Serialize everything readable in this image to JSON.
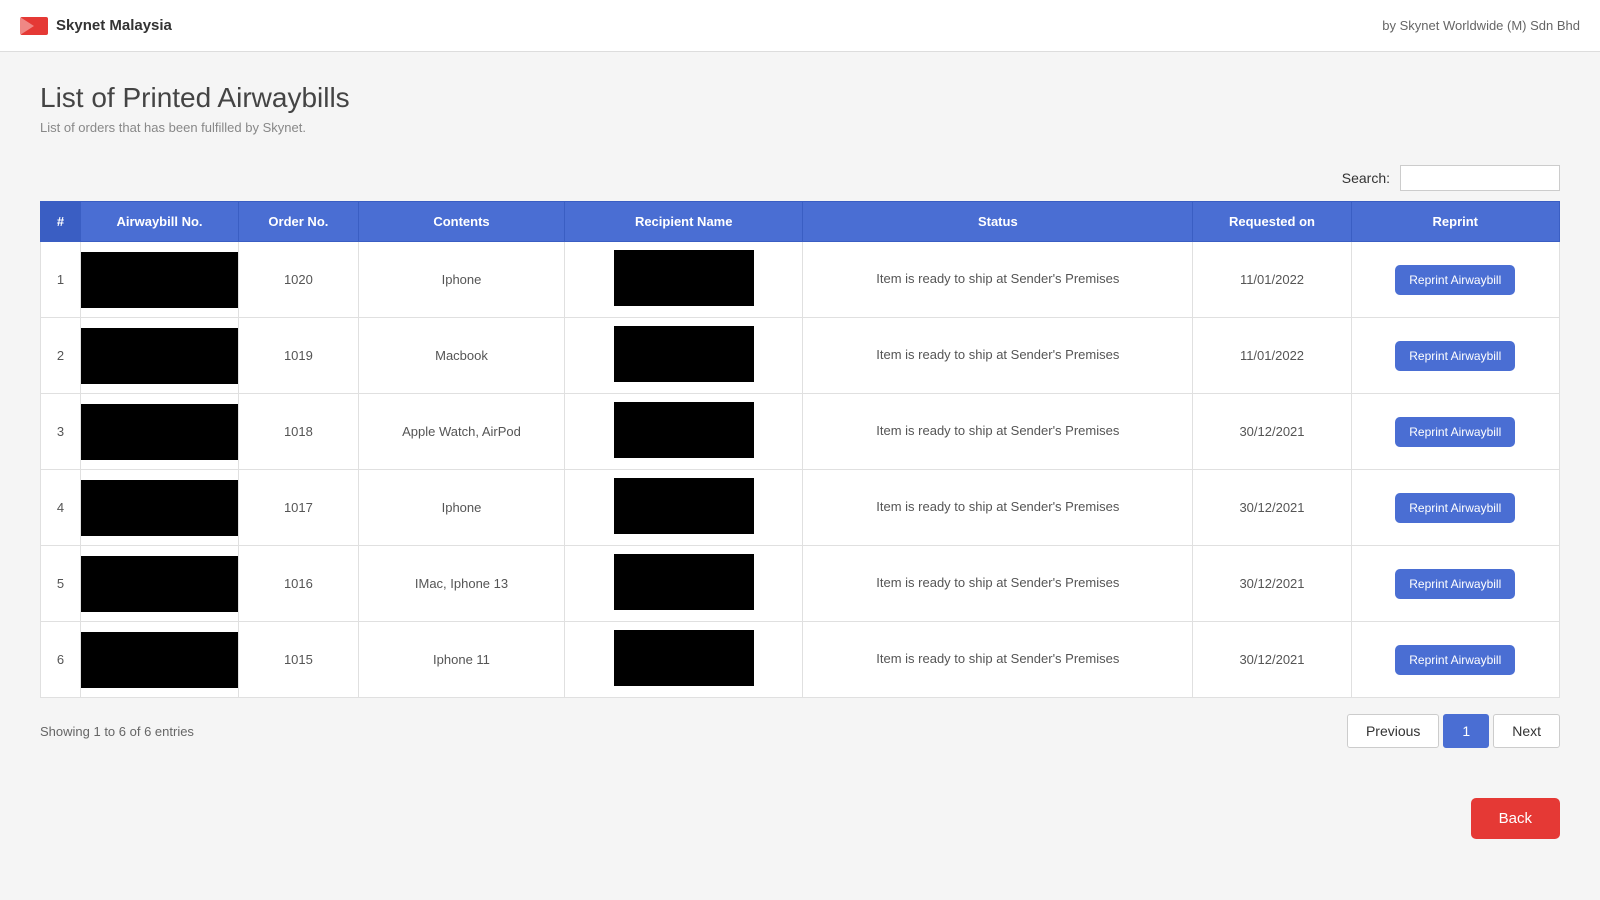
{
  "header": {
    "logo_text": "Skynet Malaysia",
    "company": "by Skynet Worldwide (M) Sdn Bhd"
  },
  "page": {
    "title": "List of Printed Airwaybills",
    "subtitle": "List of orders that has been fulfilled by Skynet."
  },
  "search": {
    "label": "Search:",
    "placeholder": ""
  },
  "table": {
    "columns": [
      "#",
      "Airwaybill No.",
      "Order No.",
      "Contents",
      "Recipient Name",
      "Status",
      "Requested on",
      "Reprint"
    ],
    "rows": [
      {
        "num": "1",
        "order_no": "1020",
        "contents": "Iphone",
        "status": "Item is ready to ship at Sender's Premises",
        "requested_on": "11/01/2022",
        "reprint_label": "Reprint Airwaybill"
      },
      {
        "num": "2",
        "order_no": "1019",
        "contents": "Macbook",
        "status": "Item is ready to ship at Sender's Premises",
        "requested_on": "11/01/2022",
        "reprint_label": "Reprint Airwaybill"
      },
      {
        "num": "3",
        "order_no": "1018",
        "contents": "Apple Watch, AirPod",
        "status": "Item is ready to ship at Sender's Premises",
        "requested_on": "30/12/2021",
        "reprint_label": "Reprint Airwaybill"
      },
      {
        "num": "4",
        "order_no": "1017",
        "contents": "Iphone",
        "status": "Item is ready to ship at Sender's Premises",
        "requested_on": "30/12/2021",
        "reprint_label": "Reprint Airwaybill"
      },
      {
        "num": "5",
        "order_no": "1016",
        "contents": "IMac, Iphone 13",
        "status": "Item is ready to ship at Sender's Premises",
        "requested_on": "30/12/2021",
        "reprint_label": "Reprint Airwaybill"
      },
      {
        "num": "6",
        "order_no": "1015",
        "contents": "Iphone 11",
        "status": "Item is ready to ship at Sender's Premises",
        "requested_on": "30/12/2021",
        "reprint_label": "Reprint Airwaybill"
      }
    ]
  },
  "footer": {
    "entries_info": "Showing 1 to 6 of 6 entries",
    "pagination": {
      "previous_label": "Previous",
      "next_label": "Next",
      "current_page": "1"
    }
  },
  "back_button": {
    "label": "Back"
  }
}
